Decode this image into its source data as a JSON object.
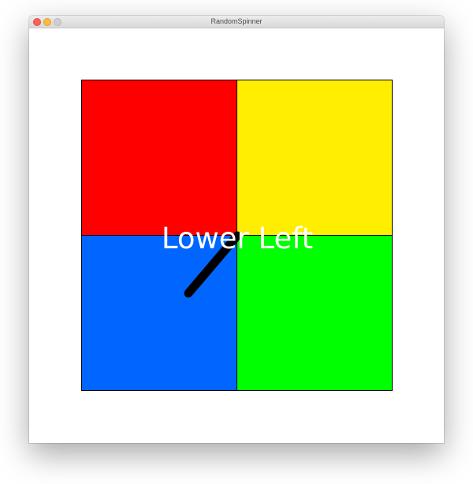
{
  "window": {
    "title": "RandomSpinner"
  },
  "spinner": {
    "quadrants": [
      {
        "id": "upper-left",
        "color": "#ff0000"
      },
      {
        "id": "upper-right",
        "color": "#ffee00"
      },
      {
        "id": "lower-left",
        "color": "#0066ff"
      },
      {
        "id": "lower-right",
        "color": "#00ff00"
      }
    ],
    "result_label": "Lower Left",
    "needle_color": "#000000",
    "needle_direction": "lower-left"
  }
}
